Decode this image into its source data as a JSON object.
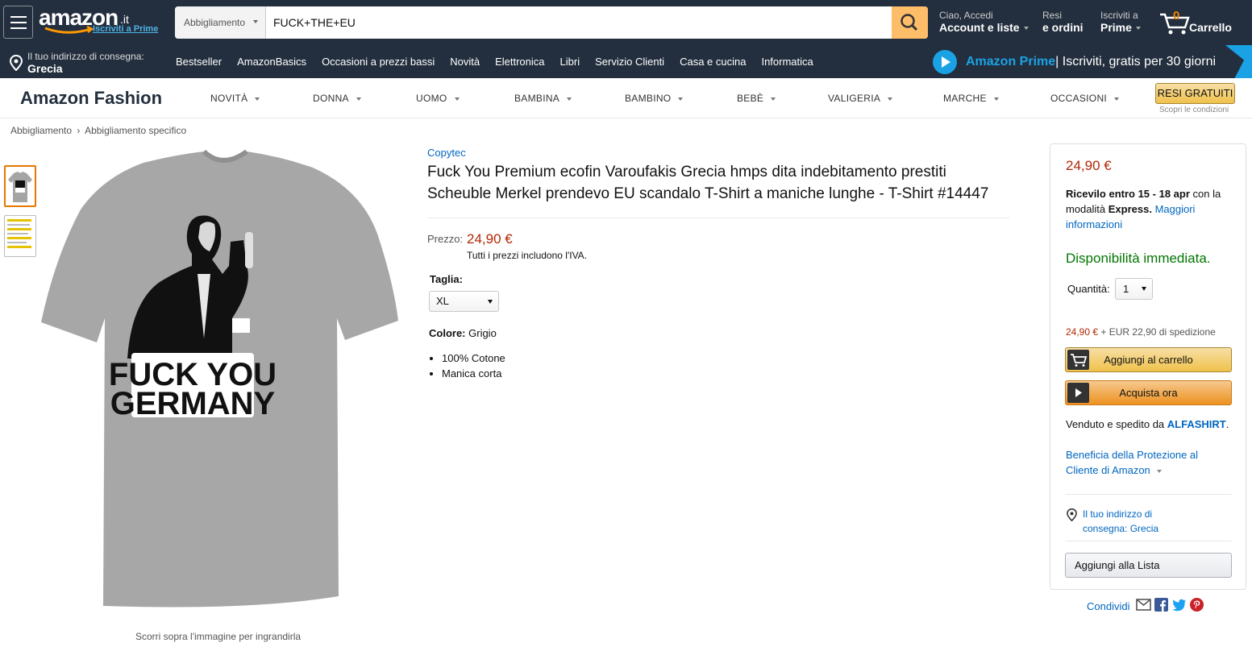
{
  "header": {
    "logo_text": "amazon",
    "logo_tld": ".it",
    "logo_prime": "Iscriviti a Prime",
    "search": {
      "category": "Abbigliamento",
      "query": "FUCK+THE+EU"
    },
    "account": {
      "line1": "Ciao, Accedi",
      "line2": "Account e liste"
    },
    "orders": {
      "line1": "Resi",
      "line2": "e ordini"
    },
    "prime": {
      "line1": "Iscriviti a",
      "line2": "Prime"
    },
    "cart": {
      "count": "0",
      "label": "Carrello"
    }
  },
  "subnav": {
    "deliver_line1": "Il tuo indirizzo di consegna:",
    "deliver_line2": "Grecia",
    "links": [
      "Bestseller",
      "AmazonBasics",
      "Occasioni a prezzi bassi",
      "Novità",
      "Elettronica",
      "Libri",
      "Servizio Clienti",
      "Casa e cucina",
      "Informatica"
    ],
    "promo_brand": "Amazon Prime",
    "promo_text": " | Iscriviti, gratis per 30 giorni"
  },
  "fashion": {
    "title": "Amazon Fashion",
    "nav": [
      "NOVITÀ",
      "DONNA",
      "UOMO",
      "BAMBINA",
      "BAMBINO",
      "BEBÈ",
      "VALIGERIA",
      "MARCHE",
      "OCCASIONI"
    ],
    "resi_button": "RESI GRATUITI",
    "resi_sub": "Scopri le condizioni"
  },
  "breadcrumb": [
    "Abbigliamento",
    "›",
    "Abbigliamento specifico"
  ],
  "product": {
    "image_print_line1": "FUCK YOU",
    "image_print_line2": "GERMANY",
    "image_caption": "Scorri sopra l'immagine per ingrandirla",
    "brand": "Copytec",
    "title": "Fuck You Premium ecofin Varoufakis Grecia hmps dita indebitamento prestiti Scheuble Merkel prendevo EU scandalo T-Shirt a maniche lunghe - T-Shirt #14447",
    "price_label": "Prezzo:",
    "price": "24,90 €",
    "iva_note": "Tutti i prezzi includono l'IVA.",
    "size_label": "Taglia:",
    "size_selected": "XL",
    "color_label": "Colore:",
    "color_value": "Grigio",
    "bullets": [
      "100% Cotone",
      "Manica corta"
    ],
    "shirt_color": "#a7a7a7"
  },
  "buybox": {
    "price": "24,90 €",
    "delivery_prefix": "Ricevilo entro 15 - 18 apr",
    "delivery_mid": " con la modalità ",
    "delivery_bold": "Express.",
    "delivery_link": "Maggiori informazioni",
    "availability": "Disponibilità immediata.",
    "qty_label": "Quantità:",
    "qty_value": "1",
    "ship_price": "24,90 €",
    "ship_text": "+ EUR 22,90 di spedizione",
    "add_to_cart": "Aggiungi al carrello",
    "buy_now": "Acquista ora",
    "sold_prefix": "Venduto e spedito da ",
    "seller": "ALFASHIRT",
    "sold_suffix": ".",
    "protection": "Beneficia della Protezione al Cliente di Amazon",
    "address_line1": "Il tuo indirizzo di",
    "address_line2": "consegna: Grecia",
    "add_to_list": "Aggiungi alla Lista"
  },
  "share": {
    "label": "Condividi"
  },
  "colors": {
    "nav_bg": "#232f3e",
    "accent": "#febd69",
    "link": "#0066c0",
    "price": "#b12704",
    "prime_blue": "#1aa2e4",
    "in_stock": "#007600"
  }
}
